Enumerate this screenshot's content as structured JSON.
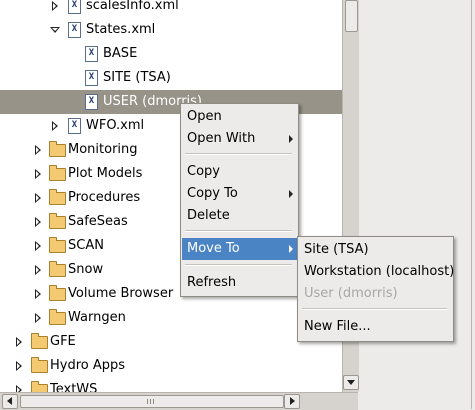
{
  "tree": {
    "items": [
      {
        "label": "scalesInfo.xml",
        "kind": "file",
        "twisty": "collapsed",
        "selected": false
      },
      {
        "label": "States.xml",
        "kind": "file",
        "twisty": "expanded",
        "selected": false
      },
      {
        "label": "BASE",
        "kind": "file",
        "twisty": "none",
        "selected": false
      },
      {
        "label": "SITE (TSA)",
        "kind": "file",
        "twisty": "none",
        "selected": false
      },
      {
        "label": "USER (dmorris)",
        "kind": "file",
        "twisty": "none",
        "selected": true
      },
      {
        "label": "WFO.xml",
        "kind": "file",
        "twisty": "collapsed",
        "selected": false
      },
      {
        "label": "Monitoring",
        "kind": "folder",
        "twisty": "collapsed",
        "selected": false
      },
      {
        "label": "Plot Models",
        "kind": "folder",
        "twisty": "collapsed",
        "selected": false
      },
      {
        "label": "Procedures",
        "kind": "folder",
        "twisty": "collapsed",
        "selected": false
      },
      {
        "label": "SafeSeas",
        "kind": "folder",
        "twisty": "collapsed",
        "selected": false
      },
      {
        "label": "SCAN",
        "kind": "folder",
        "twisty": "collapsed",
        "selected": false
      },
      {
        "label": "Snow",
        "kind": "folder",
        "twisty": "collapsed",
        "selected": false
      },
      {
        "label": "Volume Browser",
        "kind": "folder",
        "twisty": "collapsed",
        "selected": false
      },
      {
        "label": "Warngen",
        "kind": "folder",
        "twisty": "collapsed",
        "selected": false
      },
      {
        "label": "GFE",
        "kind": "folder",
        "twisty": "collapsed",
        "selected": false
      },
      {
        "label": "Hydro Apps",
        "kind": "folder",
        "twisty": "collapsed",
        "selected": false
      },
      {
        "label": "TextWS",
        "kind": "folder",
        "twisty": "collapsed",
        "selected": false
      }
    ]
  },
  "file_icon_glyph": "X",
  "context_menu": {
    "items": [
      {
        "label": "Open",
        "submenu": false
      },
      {
        "label": "Open With",
        "submenu": true
      },
      {
        "label": "Copy",
        "submenu": false
      },
      {
        "label": "Copy To",
        "submenu": true
      },
      {
        "label": "Delete",
        "submenu": false
      },
      {
        "label": "Move To",
        "submenu": true,
        "active": true
      },
      {
        "label": "Refresh",
        "submenu": false
      }
    ]
  },
  "submenu": {
    "items": [
      {
        "label": "Site (TSA)",
        "enabled": true
      },
      {
        "label": "Workstation (localhost)",
        "enabled": true
      },
      {
        "label": "User (dmorris)",
        "enabled": false
      },
      {
        "label": "New File...",
        "enabled": true
      }
    ]
  },
  "colors": {
    "selection": "#989388",
    "menu_highlight": "#4a84c5",
    "disabled_text": "#a9a7a3",
    "folder": "#f3c971"
  }
}
